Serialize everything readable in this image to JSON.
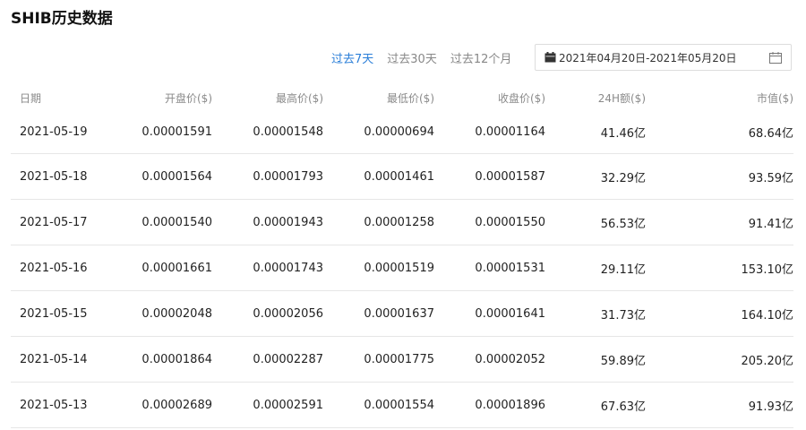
{
  "page": {
    "title": "SHIB历史数据"
  },
  "filters": {
    "ranges": [
      {
        "label": "过去7天",
        "active": true
      },
      {
        "label": "过去30天",
        "active": false
      },
      {
        "label": "过去12个月",
        "active": false
      }
    ],
    "date_range": "2021年04月20日-2021年05月20日"
  },
  "table": {
    "columns": [
      "日期",
      "开盘价($)",
      "最高价($)",
      "最低价($)",
      "收盘价($)",
      "24H额($)",
      "市值($)"
    ],
    "rows": [
      [
        "2021-05-19",
        "0.00001591",
        "0.00001548",
        "0.00000694",
        "0.00001164",
        "41.46亿",
        "68.64亿"
      ],
      [
        "2021-05-18",
        "0.00001564",
        "0.00001793",
        "0.00001461",
        "0.00001587",
        "32.29亿",
        "93.59亿"
      ],
      [
        "2021-05-17",
        "0.00001540",
        "0.00001943",
        "0.00001258",
        "0.00001550",
        "56.53亿",
        "91.41亿"
      ],
      [
        "2021-05-16",
        "0.00001661",
        "0.00001743",
        "0.00001519",
        "0.00001531",
        "29.11亿",
        "153.10亿"
      ],
      [
        "2021-05-15",
        "0.00002048",
        "0.00002056",
        "0.00001637",
        "0.00001641",
        "31.73亿",
        "164.10亿"
      ],
      [
        "2021-05-14",
        "0.00001864",
        "0.00002287",
        "0.00001775",
        "0.00002052",
        "59.89亿",
        "205.20亿"
      ],
      [
        "2021-05-13",
        "0.00002689",
        "0.00002591",
        "0.00001554",
        "0.00001896",
        "67.63亿",
        "91.93亿"
      ]
    ]
  },
  "colors": {
    "accent": "#2a7ed8",
    "muted": "#888888",
    "border": "#e6e6e6"
  },
  "icons": {
    "date_left": "calendar-icon",
    "date_right": "calendar-picker-icon"
  }
}
